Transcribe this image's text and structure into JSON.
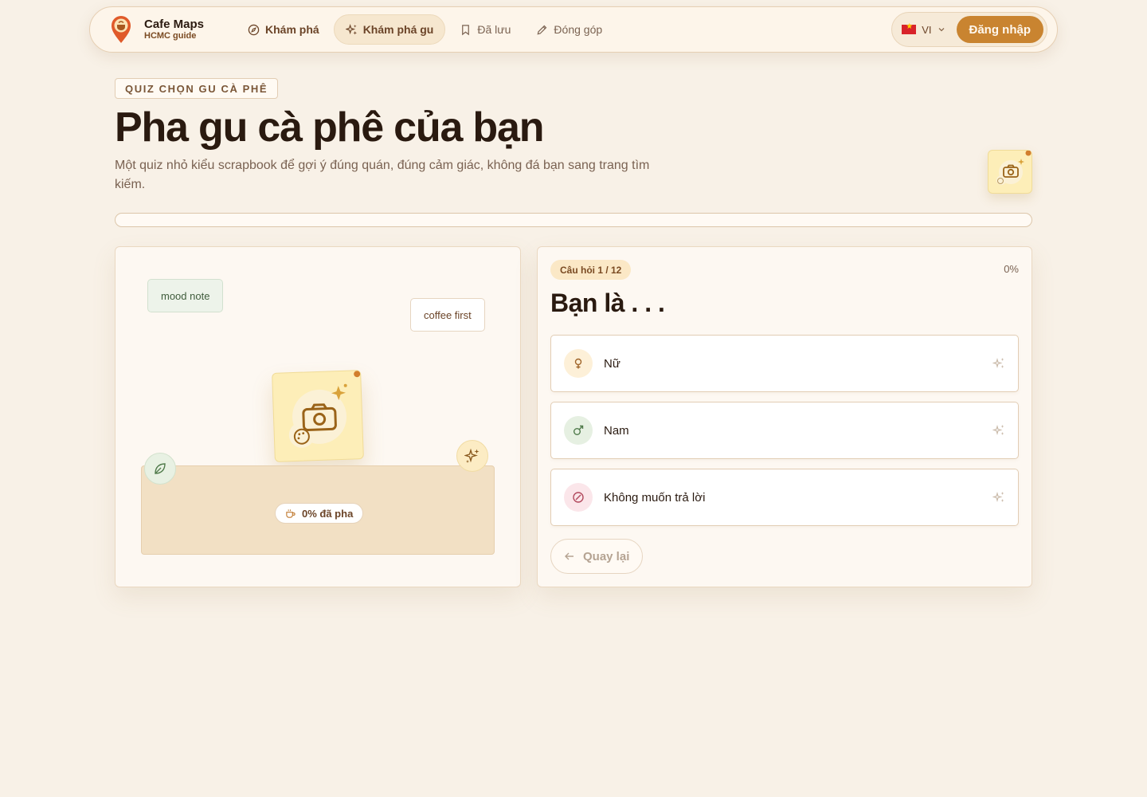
{
  "nav": {
    "brand_name": "Cafe Maps",
    "brand_sub": "HCMC guide",
    "links": [
      {
        "label": "Khám phá",
        "icon": "compass-icon"
      },
      {
        "label": "Khám phá gu",
        "icon": "sparkles-icon"
      },
      {
        "label": "Đã lưu",
        "icon": "bookmark-icon"
      },
      {
        "label": "Đóng góp",
        "icon": "pencil-icon"
      }
    ],
    "active_link": "Khám phá gu",
    "language": "VI",
    "login_label": "Đăng nhập"
  },
  "header": {
    "eyebrow": "QUIZ CHỌN GU CÀ PHÊ",
    "title": "Pha gu cà phê của bạn",
    "description": "Một quiz nhỏ kiểu scrapbook để gợi ý đúng quán, đúng cảm giác, không đá bạn sang trang tìm kiếm."
  },
  "progress": {
    "value": 0
  },
  "scrapbook": {
    "tag_mood": "mood note",
    "tag_coffee": "coffee first",
    "brew_status": "0% đã pha"
  },
  "quiz": {
    "counter": "Câu hỏi 1 / 12",
    "percent": "0%",
    "question": "Bạn là . . .",
    "options": [
      {
        "label": "Nữ",
        "icon": "female-icon"
      },
      {
        "label": "Nam",
        "icon": "male-icon"
      },
      {
        "label": "Không muốn trả lời",
        "icon": "prohibited-icon"
      }
    ],
    "back_label": "Quay lại"
  },
  "colors": {
    "accent": "#c98430",
    "background": "#f8f1e7",
    "text": "#2a1a10"
  }
}
